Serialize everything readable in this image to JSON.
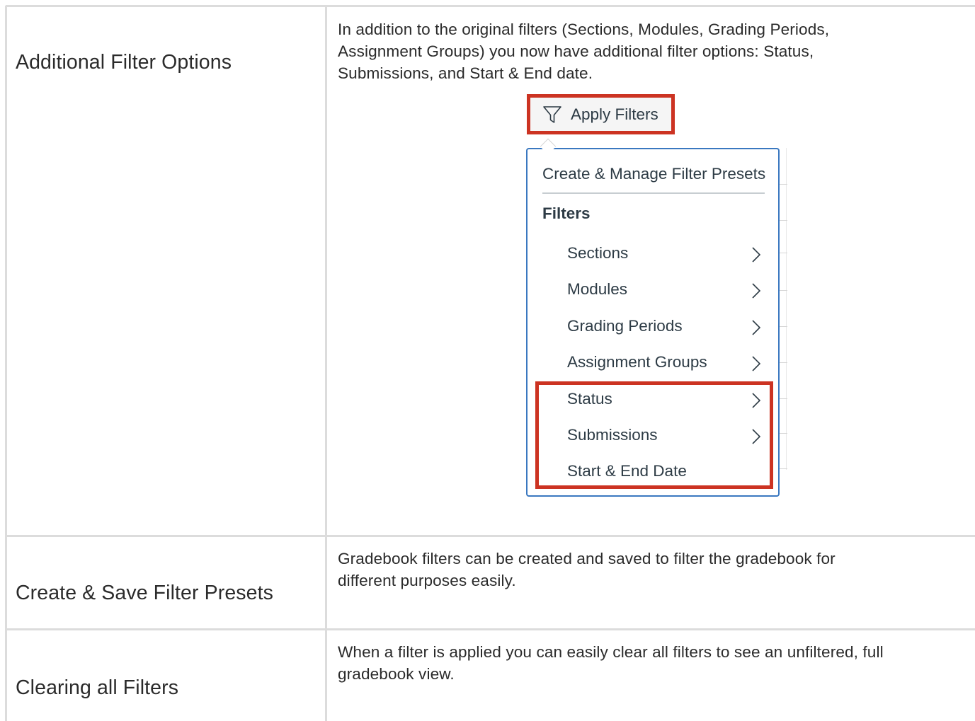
{
  "rows": [
    {
      "feature": "Additional Filter Options",
      "description_lines": [
        "In addition to the original filters (Sections, Modules, Grading Periods,",
        "Assignment Groups) you now have additional filter options:  Status,",
        "Submissions, and Start & End date."
      ]
    },
    {
      "feature": "Create & Save Filter Presets",
      "description_lines": [
        "Gradebook filters can be created and saved to filter the gradebook for",
        "different purposes easily."
      ]
    },
    {
      "feature": "Clearing all Filters",
      "description_lines": [
        "When a filter is applied you can easily clear all filters to see an unfiltered, full",
        "gradebook view."
      ]
    }
  ],
  "filter_ui": {
    "apply_button_label": "Apply Filters",
    "apply_button_icon": "funnel-icon",
    "menu_header": "Create & Manage Filter Presets",
    "group_label": "Filters",
    "items": [
      {
        "label": "Sections",
        "has_submenu": true
      },
      {
        "label": "Modules",
        "has_submenu": true
      },
      {
        "label": "Grading Periods",
        "has_submenu": true
      },
      {
        "label": "Assignment Groups",
        "has_submenu": true
      },
      {
        "label": "Status",
        "has_submenu": true
      },
      {
        "label": "Submissions",
        "has_submenu": true
      },
      {
        "label": "Start & End Date",
        "has_submenu": false
      }
    ],
    "highlight_color": "#cc3322",
    "menu_border_color": "#3a78c0"
  }
}
